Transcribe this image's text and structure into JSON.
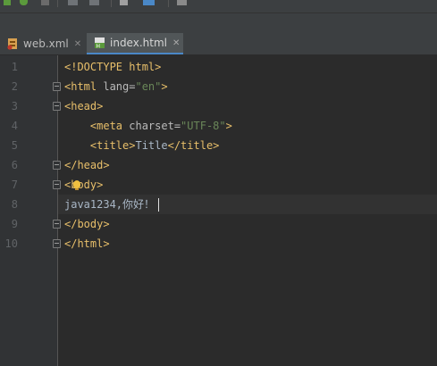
{
  "tabs": [
    {
      "label": "web.xml",
      "icon": "xml-file-icon",
      "close": "✕"
    },
    {
      "label": "index.html",
      "icon": "html-file-icon",
      "close": "✕",
      "active": true
    }
  ],
  "lines": [
    {
      "num": "1",
      "segments": [
        {
          "t": "<!DOCTYPE html>",
          "c": "tag"
        }
      ]
    },
    {
      "num": "2",
      "segments": [
        {
          "t": "<html ",
          "c": "tag"
        },
        {
          "t": "lang=",
          "c": "attr"
        },
        {
          "t": "\"en\"",
          "c": "val"
        },
        {
          "t": ">",
          "c": "tag"
        }
      ]
    },
    {
      "num": "3",
      "segments": [
        {
          "t": "<head>",
          "c": "tag"
        }
      ]
    },
    {
      "num": "4",
      "segments": [
        {
          "t": "    <meta ",
          "c": "tag"
        },
        {
          "t": "charset=",
          "c": "attr"
        },
        {
          "t": "\"UTF-8\"",
          "c": "val"
        },
        {
          "t": ">",
          "c": "tag"
        }
      ]
    },
    {
      "num": "5",
      "segments": [
        {
          "t": "    <title>",
          "c": "tag"
        },
        {
          "t": "Title",
          "c": "txt"
        },
        {
          "t": "</title>",
          "c": "tag"
        }
      ]
    },
    {
      "num": "6",
      "segments": [
        {
          "t": "</head>",
          "c": "tag"
        }
      ]
    },
    {
      "num": "7",
      "segments": [
        {
          "t": "<body>",
          "c": "tag"
        }
      ]
    },
    {
      "num": "8",
      "segments": [
        {
          "t": "java1234,你好！",
          "c": "txt"
        }
      ],
      "current": true
    },
    {
      "num": "9",
      "segments": [
        {
          "t": "</body>",
          "c": "tag"
        }
      ]
    },
    {
      "num": "10",
      "segments": [
        {
          "t": "</html>",
          "c": "tag"
        }
      ]
    }
  ],
  "colors": {
    "tag": "#e8bf6a",
    "attr": "#bababa",
    "value": "#6a8759",
    "text": "#a9b7c6",
    "background": "#2b2b2b",
    "gutter": "#313335",
    "active_tab_underline": "#4a88c7"
  },
  "toolbar_icons": [
    "run-icon",
    "debug-icon",
    "stop-icon",
    "build-icon",
    "coverage-icon",
    "wrench-icon",
    "structure-icon",
    "save-icon"
  ]
}
